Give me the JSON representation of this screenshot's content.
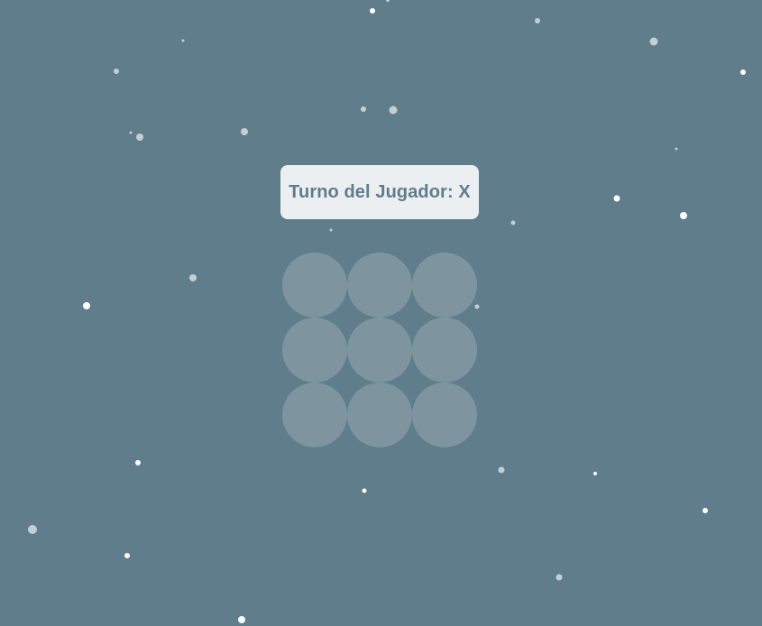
{
  "game": {
    "status_text": "Turno del Jugador: X",
    "current_player": "X",
    "board": [
      "",
      "",
      "",
      "",
      "",
      "",
      "",
      "",
      ""
    ]
  },
  "colors": {
    "background": "#607d8b",
    "panel_background": "#eceff1",
    "panel_text": "#607d8b",
    "cell_fill": "#7e959f",
    "snow_bright": "#ffffff",
    "snow_dim": "#c4cfd4"
  }
}
